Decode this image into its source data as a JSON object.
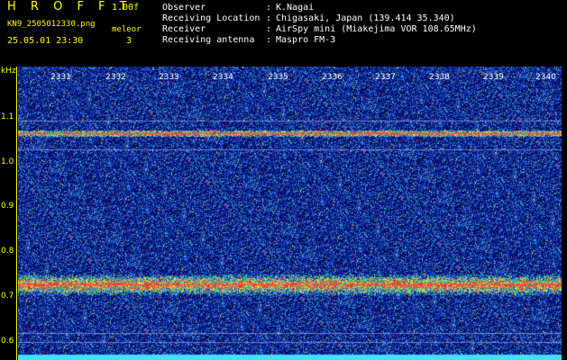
{
  "header": {
    "app_title": "H R O F F T",
    "version": "1.00f",
    "file_name": "KN9_2505012330.png",
    "mode_label": "meleor",
    "datetime": "25.05.01 23:30",
    "mode_value": "3"
  },
  "info": [
    {
      "key": "Observer",
      "value": "K.Nagai"
    },
    {
      "key": "Receiving Location",
      "value": "Chigasaki, Japan (139.414 35.340)"
    },
    {
      "key": "Receiver",
      "value": "AirSpy mini (Miakejima VOR 108.65MHz)"
    },
    {
      "key": "Receiving antenna",
      "value": "Maspro FM-3"
    }
  ],
  "info_separator": ":",
  "axis": {
    "unit": "kHz",
    "y_ticks": [
      "1.1",
      "1.0",
      "0.9",
      "0.8",
      "0.7",
      "0.6"
    ],
    "x_ticks": [
      "2331",
      "2332",
      "2333",
      "2334",
      "2335",
      "2336",
      "2337",
      "2338",
      "2339",
      "2340"
    ]
  },
  "colors": {
    "label_yellow": "#ffff00",
    "text_white": "#ffffff",
    "background_blue": "#05106a",
    "signal_red": "#ff2020"
  }
}
